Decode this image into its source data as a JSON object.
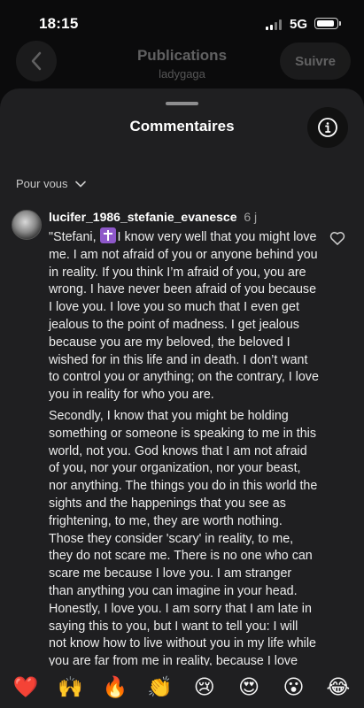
{
  "status_bar": {
    "time": "18:15",
    "network": "5G"
  },
  "background": {
    "title": "Publications",
    "subtitle": "ladygaga",
    "follow_label": "Suivre"
  },
  "sheet": {
    "title": "Commentaires",
    "sort_label": "Pour vous"
  },
  "comment": {
    "username": "lucifer_1986_stefanie_evanesce",
    "time": "6 j",
    "opening": "\"Stefani,",
    "paragraph1_rest": "I know very well that you might love me. I am not afraid of you or anyone behind you in reality. If you think I’m afraid of you, you are wrong. I have never been afraid of you because I love you. I love you so much that I even get jealous to the point of madness. I get jealous because you are my beloved, the beloved I wished for in this life and in death. I don’t want to control you or anything; on the contrary, I love you in reality for who you are.",
    "paragraph2": "Secondly, I know that you might be holding something or someone is speaking to me in this world, not you. God knows that I am not afraid of you, nor your organization, nor your beast, nor anything. The things you do in this world the sights and the happenings that you see as frightening, to me, they are worth nothing. Those they consider 'scary' in reality, to me, they do not scare me. There is no one who can scare me because I love you. I am stranger than anything you can imagine in your head. Honestly, I love you. I am sorry that I am late in saying this to you, but I want to tell you: I will not know how to live without you in my life while you are far from me in reality, because I love you, and I respect that I cannot live without you."
  },
  "reactions": [
    "❤️",
    "🙌",
    "🔥",
    "👏",
    "😢",
    "😍",
    "😮",
    "😂"
  ],
  "colors": {
    "sheet_bg": "#1f1f21",
    "page_bg": "#0b0b0c",
    "cross_emoji_bg": "#8e58c9"
  }
}
